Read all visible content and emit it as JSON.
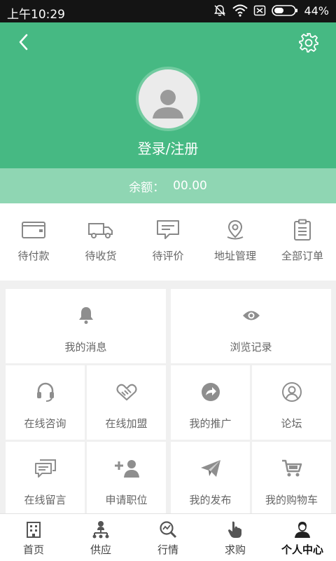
{
  "status_bar": {
    "time": "上午10:29",
    "battery": "44%",
    "icons": [
      "alarm-off-icon",
      "wifi-icon",
      "sim-blocked-icon",
      "battery-icon"
    ]
  },
  "header": {
    "back_icon": "chevron-left-icon",
    "settings_icon": "gear-icon",
    "avatar_icon": "user-silhouette-icon",
    "login_text": "登录/注册",
    "colors": {
      "header_bg": "#46b983",
      "balance_bg": "#8fd6b3"
    }
  },
  "balance": {
    "label": "余额：",
    "value": "00.00"
  },
  "order_shortcuts": [
    {
      "label": "待付款",
      "icon": "wallet-icon"
    },
    {
      "label": "待收货",
      "icon": "truck-icon"
    },
    {
      "label": "待评价",
      "icon": "comment-icon"
    },
    {
      "label": "地址管理",
      "icon": "location-pin-icon"
    },
    {
      "label": "全部订单",
      "icon": "clipboard-icon"
    }
  ],
  "menu": {
    "messages": {
      "label": "我的消息",
      "icon": "bell-icon"
    },
    "history": {
      "label": "浏览记录",
      "icon": "eye-icon"
    },
    "consult": {
      "label": "在线咨询",
      "icon": "headset-icon"
    },
    "join": {
      "label": "在线加盟",
      "icon": "handshake-icon"
    },
    "promote": {
      "label": "我的推广",
      "icon": "share-arrow-icon"
    },
    "forum": {
      "label": "论坛",
      "icon": "user-circle-icon"
    },
    "leave_message": {
      "label": "在线留言",
      "icon": "chat-bubbles-icon"
    },
    "apply_job": {
      "label": "申请职位",
      "icon": "add-user-icon"
    },
    "publish": {
      "label": "我的发布",
      "icon": "paper-plane-icon"
    },
    "cart": {
      "label": "我的购物车",
      "icon": "cart-icon"
    }
  },
  "tabbar": {
    "active": "个人中心",
    "items": [
      {
        "label": "首页",
        "icon": "building-icon"
      },
      {
        "label": "供应",
        "icon": "network-icon"
      },
      {
        "label": "行情",
        "icon": "chart-search-icon"
      },
      {
        "label": "求购",
        "icon": "hand-pointer-icon"
      },
      {
        "label": "个人中心",
        "icon": "person-icon"
      }
    ]
  }
}
